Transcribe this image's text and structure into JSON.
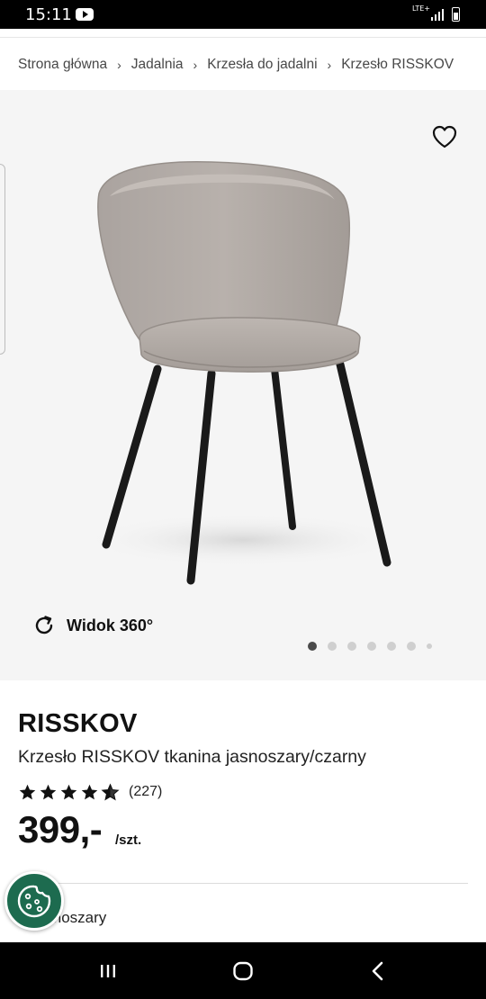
{
  "status_bar": {
    "time": "15:11",
    "network": "LTE+",
    "icons": [
      "youtube-icon",
      "signal-icon",
      "battery-icon"
    ]
  },
  "breadcrumb": {
    "items": [
      "Strona główna",
      "Jadalnia",
      "Krzesła do jadalni",
      "Krzesło RISSKOV"
    ]
  },
  "gallery": {
    "view360_label": "Widok 360°",
    "dot_count": 7,
    "active_dot": 1,
    "background": "#f5f5f5"
  },
  "product": {
    "brand": "RISSKOV",
    "subtitle": "Krzesło RISSKOV tkanina jasnoszary/czarny",
    "rating": 4.5,
    "review_count": "(227)",
    "price": "399,-",
    "unit": "/szt.",
    "color_label": "r:",
    "color_value": "jasnoszary"
  },
  "colors": {
    "cookie_button": "#1d6b4f",
    "text": "#111111"
  }
}
